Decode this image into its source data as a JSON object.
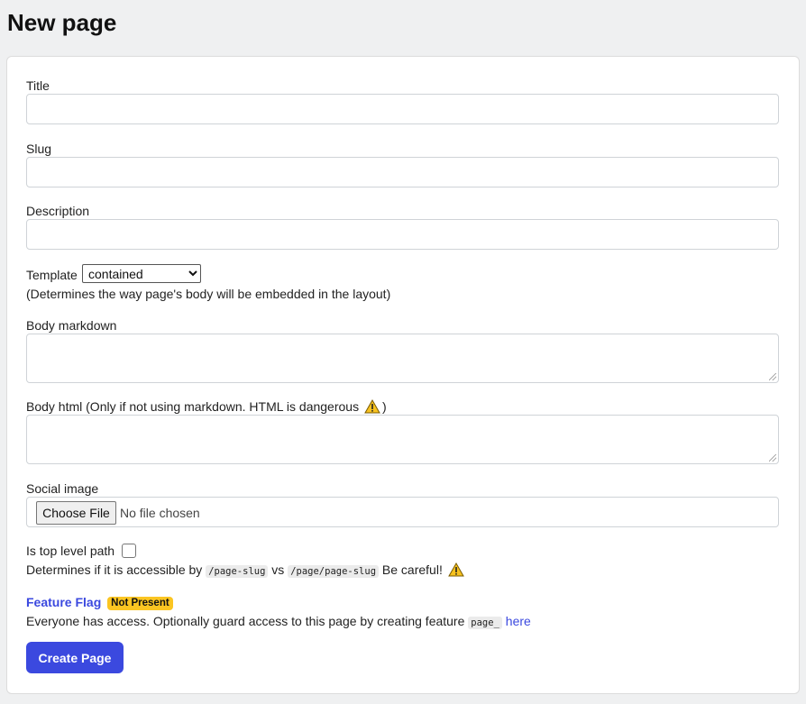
{
  "page_title": "New page",
  "form": {
    "title_label": "Title",
    "title_value": "",
    "slug_label": "Slug",
    "slug_value": "",
    "description_label": "Description",
    "description_value": "",
    "template_label": "Template",
    "template_selected": "contained",
    "template_hint": "(Determines the way page's body will be embedded in the layout)",
    "body_markdown_label": "Body markdown",
    "body_markdown_value": "",
    "body_html_label": "Body html (Only if not using markdown. HTML is dangerous",
    "body_html_label_end": ")",
    "body_html_value": "",
    "social_image_label": "Social image",
    "choose_file_label": "Choose File",
    "no_file_text": "No file chosen",
    "top_level_label": "Is top level path",
    "top_level_checked": false,
    "top_level_hint_prefix": "Determines if it is accessible by",
    "top_level_code_1": "/page-slug",
    "top_level_vs": "vs",
    "top_level_code_2": "/page/page-slug",
    "top_level_careful": "Be careful!",
    "feature_flag_title": "Feature Flag",
    "feature_flag_badge": "Not Present",
    "feature_flag_text": "Everyone has access. Optionally guard access to this page by creating feature",
    "feature_flag_code": "page_",
    "feature_flag_link": "here",
    "submit_label": "Create Page"
  },
  "colors": {
    "accent": "#3b49df",
    "badge": "#fbc522",
    "background": "#eff0f1"
  },
  "icons": [
    "warning-icon",
    "chevron-down-icon"
  ]
}
